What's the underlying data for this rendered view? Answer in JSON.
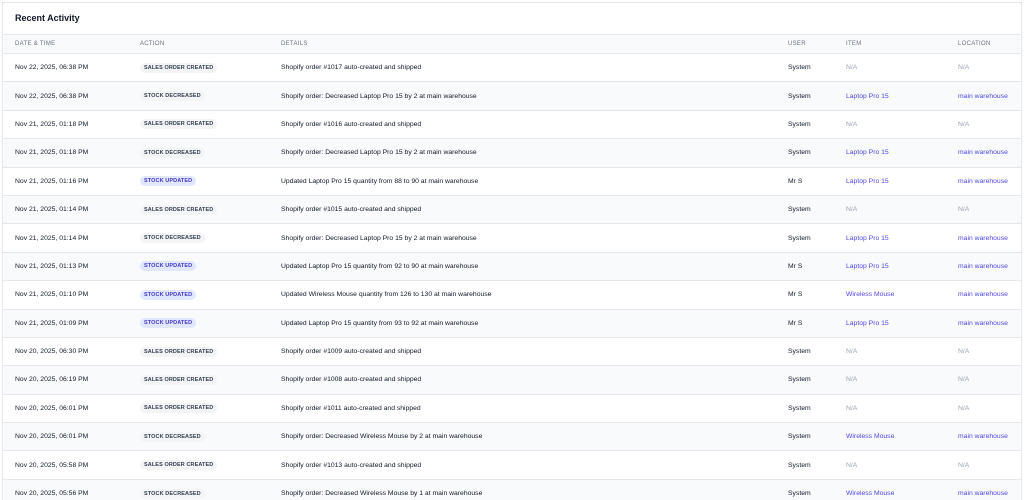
{
  "panel": {
    "title": "Recent Activity"
  },
  "columns": {
    "datetime": "DATE & TIME",
    "action": "ACTION",
    "details": "DETAILS",
    "user": "USER",
    "item": "ITEM",
    "location": "LOCATION"
  },
  "rows": [
    {
      "datetime": "Nov 22, 2025, 06:38 PM",
      "action": "SALES ORDER CREATED",
      "action_style": "gray",
      "details": "Shopify order #1017 auto-created and shipped",
      "user": "System",
      "item": "N/A",
      "location": "N/A"
    },
    {
      "datetime": "Nov 22, 2025, 06:38 PM",
      "action": "STOCK DECREASED",
      "action_style": "gray",
      "details": "Shopify order: Decreased Laptop Pro 15 by 2 at main warehouse",
      "user": "System",
      "item": "Laptop Pro 15",
      "location": "main warehouse"
    },
    {
      "datetime": "Nov 21, 2025, 01:18 PM",
      "action": "SALES ORDER CREATED",
      "action_style": "gray",
      "details": "Shopify order #1016 auto-created and shipped",
      "user": "System",
      "item": "N/A",
      "location": "N/A"
    },
    {
      "datetime": "Nov 21, 2025, 01:18 PM",
      "action": "STOCK DECREASED",
      "action_style": "gray",
      "details": "Shopify order: Decreased Laptop Pro 15 by 2 at main warehouse",
      "user": "System",
      "item": "Laptop Pro 15",
      "location": "main warehouse"
    },
    {
      "datetime": "Nov 21, 2025, 01:16 PM",
      "action": "STOCK UPDATED",
      "action_style": "blue",
      "details": "Updated Laptop Pro 15 quantity from 88 to 90 at main warehouse",
      "user": "Mr S",
      "item": "Laptop Pro 15",
      "location": "main warehouse"
    },
    {
      "datetime": "Nov 21, 2025, 01:14 PM",
      "action": "SALES ORDER CREATED",
      "action_style": "gray",
      "details": "Shopify order #1015 auto-created and shipped",
      "user": "System",
      "item": "N/A",
      "location": "N/A"
    },
    {
      "datetime": "Nov 21, 2025, 01:14 PM",
      "action": "STOCK DECREASED",
      "action_style": "gray",
      "details": "Shopify order: Decreased Laptop Pro 15 by 2 at main warehouse",
      "user": "System",
      "item": "Laptop Pro 15",
      "location": "main warehouse"
    },
    {
      "datetime": "Nov 21, 2025, 01:13 PM",
      "action": "STOCK UPDATED",
      "action_style": "blue",
      "details": "Updated Laptop Pro 15 quantity from 92 to 90 at main warehouse",
      "user": "Mr S",
      "item": "Laptop Pro 15",
      "location": "main warehouse"
    },
    {
      "datetime": "Nov 21, 2025, 01:10 PM",
      "action": "STOCK UPDATED",
      "action_style": "blue",
      "details": "Updated Wireless Mouse quantity from 126 to 130 at main warehouse",
      "user": "Mr S",
      "item": "Wireless Mouse",
      "location": "main warehouse"
    },
    {
      "datetime": "Nov 21, 2025, 01:09 PM",
      "action": "STOCK UPDATED",
      "action_style": "blue",
      "details": "Updated Laptop Pro 15 quantity from 93 to 92 at main warehouse",
      "user": "Mr S",
      "item": "Laptop Pro 15",
      "location": "main warehouse"
    },
    {
      "datetime": "Nov 20, 2025, 06:30 PM",
      "action": "SALES ORDER CREATED",
      "action_style": "gray",
      "details": "Shopify order #1009 auto-created and shipped",
      "user": "System",
      "item": "N/A",
      "location": "N/A"
    },
    {
      "datetime": "Nov 20, 2025, 06:19 PM",
      "action": "SALES ORDER CREATED",
      "action_style": "gray",
      "details": "Shopify order #1008 auto-created and shipped",
      "user": "System",
      "item": "N/A",
      "location": "N/A"
    },
    {
      "datetime": "Nov 20, 2025, 06:01 PM",
      "action": "SALES ORDER CREATED",
      "action_style": "gray",
      "details": "Shopify order #1011 auto-created and shipped",
      "user": "System",
      "item": "N/A",
      "location": "N/A"
    },
    {
      "datetime": "Nov 20, 2025, 06:01 PM",
      "action": "STOCK DECREASED",
      "action_style": "gray",
      "details": "Shopify order: Decreased Wireless Mouse by 2 at main warehouse",
      "user": "System",
      "item": "Wireless Mouse",
      "location": "main warehouse"
    },
    {
      "datetime": "Nov 20, 2025, 05:58 PM",
      "action": "SALES ORDER CREATED",
      "action_style": "gray",
      "details": "Shopify order #1013 auto-created and shipped",
      "user": "System",
      "item": "N/A",
      "location": "N/A"
    },
    {
      "datetime": "Nov 20, 2025, 05:56 PM",
      "action": "STOCK DECREASED",
      "action_style": "gray",
      "details": "Shopify order: Decreased Wireless Mouse by 1 at main warehouse",
      "user": "System",
      "item": "Wireless Mouse",
      "location": "main warehouse"
    }
  ]
}
